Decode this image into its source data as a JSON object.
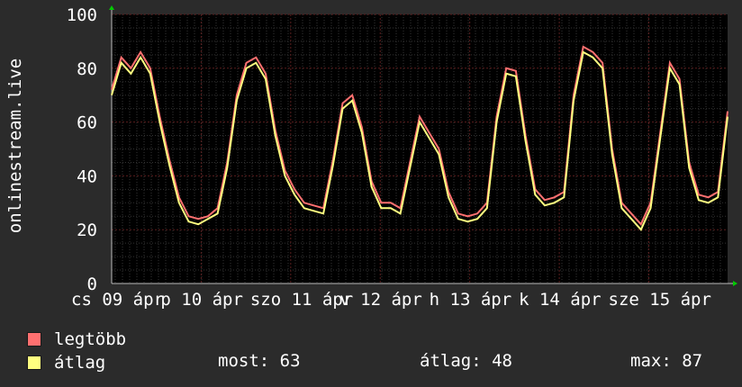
{
  "chart_data": {
    "type": "line",
    "ylabel": "onlinestream.live",
    "ylim": [
      0,
      100
    ],
    "yticks": [
      0,
      20,
      40,
      60,
      80,
      100
    ],
    "x_tick_labels": [
      "cs 09 ápr",
      "p 10 ápr",
      "szo 11 ápr",
      "v 12 ápr",
      "h 13 ápr",
      "k 14 ápr",
      "sze 15 ápr"
    ],
    "series": [
      {
        "name": "legtöbb",
        "color": "#ff7070",
        "values": [
          72,
          84,
          80,
          86,
          80,
          62,
          46,
          32,
          25,
          24,
          25,
          28,
          45,
          70,
          82,
          84,
          78,
          57,
          42,
          35,
          30,
          29,
          28,
          46,
          67,
          70,
          58,
          38,
          30,
          30,
          28,
          45,
          62,
          56,
          50,
          34,
          26,
          25,
          26,
          30,
          62,
          80,
          79,
          55,
          35,
          31,
          32,
          34,
          70,
          88,
          86,
          82,
          50,
          30,
          26,
          22,
          30,
          56,
          82,
          76,
          45,
          33,
          32,
          34,
          64
        ]
      },
      {
        "name": "átlag",
        "color": "#ffff80",
        "values": [
          70,
          82,
          78,
          84,
          78,
          60,
          44,
          30,
          23,
          22,
          24,
          26,
          43,
          68,
          80,
          82,
          76,
          55,
          40,
          33,
          28,
          27,
          26,
          44,
          65,
          68,
          56,
          36,
          28,
          28,
          26,
          43,
          60,
          54,
          48,
          32,
          24,
          23,
          24,
          28,
          60,
          78,
          77,
          53,
          33,
          29,
          30,
          32,
          68,
          86,
          84,
          80,
          48,
          28,
          24,
          20,
          28,
          54,
          80,
          74,
          43,
          31,
          30,
          32,
          62
        ]
      }
    ],
    "grid": true,
    "legend_position": "bottom"
  },
  "legend": {
    "items": [
      {
        "label": "legtöbb",
        "color": "#ff7070"
      },
      {
        "label": "átlag",
        "color": "#ffff80"
      }
    ],
    "stats": {
      "now": "most: 63",
      "avg": "átlag: 48",
      "max": "max: 87"
    }
  },
  "colors": {
    "background": "#2b2b2b",
    "plot_background": "#000000",
    "major_grid": "#5a1e1e",
    "minor_grid": "#333333",
    "axis_arrow": "#00cc00",
    "text": "#ffffff"
  }
}
